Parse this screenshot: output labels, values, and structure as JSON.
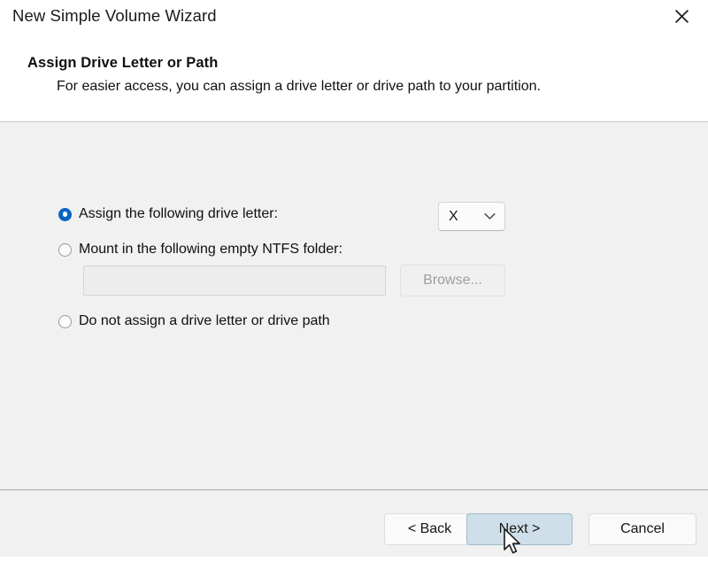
{
  "window": {
    "title": "New Simple Volume Wizard",
    "close_icon": "close-x-icon"
  },
  "header": {
    "title": "Assign Drive Letter or Path",
    "subtitle": "For easier access, you can assign a drive letter or drive path to your partition."
  },
  "options": [
    {
      "id": "assign-letter",
      "label": "Assign the following drive letter:",
      "selected": true
    },
    {
      "id": "mount-ntfs-folder",
      "label": "Mount in the following empty NTFS folder:",
      "selected": false
    },
    {
      "id": "no-letter-or-path",
      "label": "Do not assign a drive letter or drive path",
      "selected": false
    }
  ],
  "drive_letter_select": {
    "value": "X",
    "chevron_icon": "chevron-down-icon"
  },
  "mount_path_input": {
    "value": "",
    "placeholder": "",
    "enabled": false
  },
  "browse_button": {
    "label": "Browse...",
    "enabled": false
  },
  "footer": {
    "back_label": "< Back",
    "next_label": "Next >",
    "cancel_label": "Cancel"
  },
  "colors": {
    "header_background": "#ffffff",
    "body_background": "#f1f1f1",
    "radio_selected": "#0b64c4",
    "next_button_fill": "#cfdfe9",
    "next_button_border": "#9eb9cb",
    "disabled_text": "#9d9d9d"
  }
}
